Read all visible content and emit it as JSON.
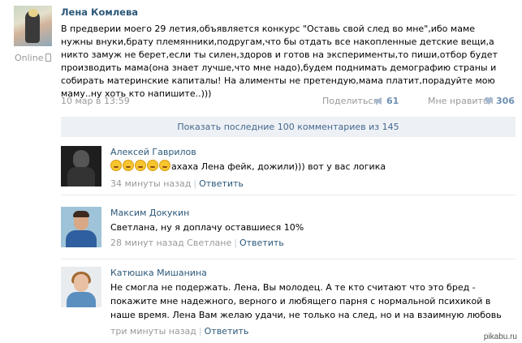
{
  "post": {
    "author": "Лена Комлева",
    "status": "Online",
    "text": "В предверии моего 29 летия,объявляется конкурс \"Оставь свой след во мне\",ибо маме нужны внуки,брату племянники,подругам,что бы отдать все накопленные детские вещи,а никто замуж не берет,если ты силен,здоров и готов на эксперименты,то пиши,отбор будет производить мама(она знает лучше,что мне надо),будем поднимать демографию страны и собирать материнские капиталы! На алименты не претендую,мама платит,порадуйте мою маму..ну хоть кто напишите..)))",
    "date": "10 мар в 13:59",
    "share_label": "Поделиться",
    "share_count": "61",
    "like_label": "Мне нравится",
    "like_count": "306"
  },
  "show_comments": "Показать последние 100 комментариев из 145",
  "comments": [
    {
      "name": "Алексей Гаврилов",
      "text": "ахаха Лена фейк, дожили))) вот у вас логика",
      "emoji_count": 5,
      "time": "34 минуты назад",
      "reply": "Ответить"
    },
    {
      "name": "Максим Докукин",
      "text": "Светлана, ну я доплачу оставшиеся 10%",
      "time": "28 минут назад Светлане",
      "reply": "Ответить"
    },
    {
      "name": "Катюшка Мишанина",
      "text": "Не смогла не подержать. Лена, Вы молодец. А те кто считают что это бред - покажите мне надежного, верного и любящего парня с нормальной психикой в наше время. Лена Вам желаю удачи, не только на след, но и на взаимную любовь",
      "time": "три минуты назад",
      "reply": "Ответить"
    }
  ],
  "watermark": "pikabu.ru",
  "colors": {
    "link": "#2b587a",
    "meta": "#999999",
    "count": "#6d8fb3",
    "show_bar": "#edf1f5"
  }
}
